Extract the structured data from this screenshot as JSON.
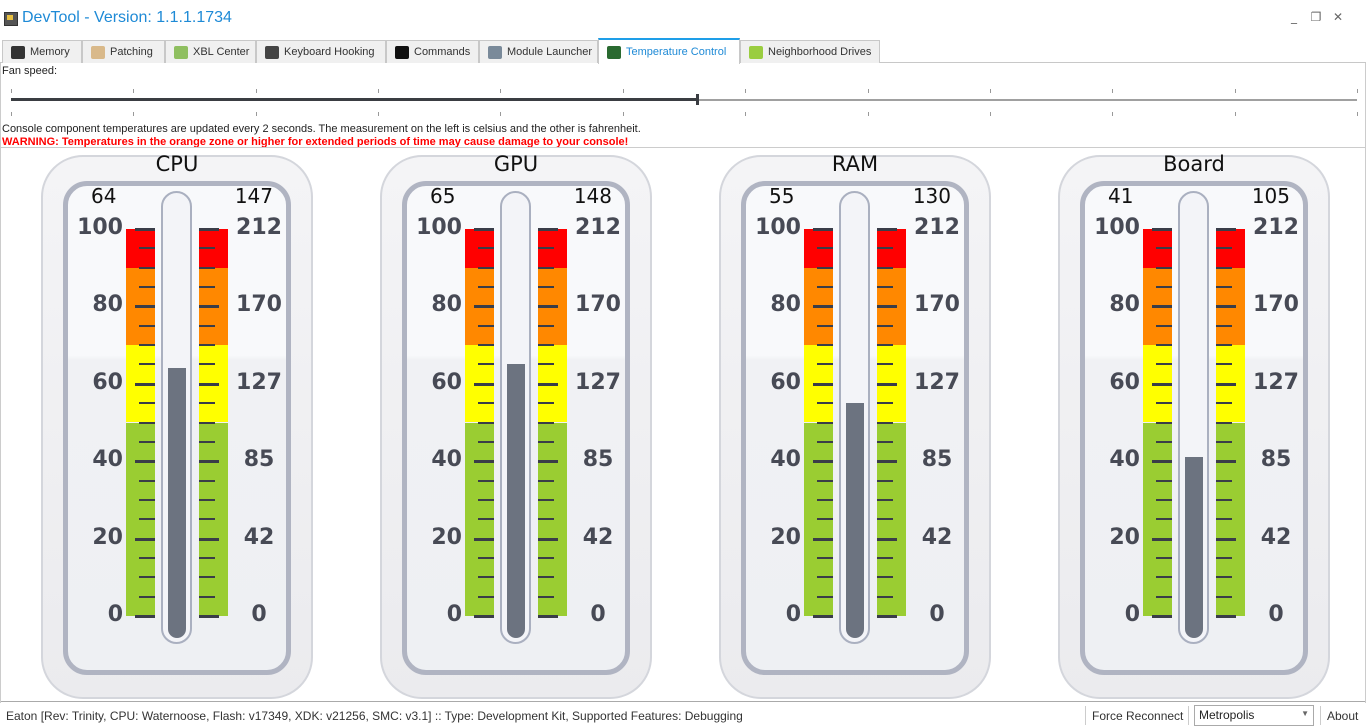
{
  "window": {
    "title": "DevTool - Version: 1.1.1.1734",
    "minimize_icon": "minimize-icon",
    "restore_icon": "restore-icon",
    "close_icon": "close-icon"
  },
  "tabs": [
    {
      "label": "Memory",
      "icon": "memory-chip-icon",
      "color": "#333333"
    },
    {
      "label": "Patching",
      "icon": "bandage-icon",
      "color": "#d9b98a"
    },
    {
      "label": "XBL Center",
      "icon": "xbox-icon",
      "color": "#8fbf60"
    },
    {
      "label": "Keyboard Hooking",
      "icon": "keyboard-icon",
      "color": "#444444"
    },
    {
      "label": "Commands",
      "icon": "console-icon",
      "color": "#111111"
    },
    {
      "label": "Module Launcher",
      "icon": "window-icon",
      "color": "#7a8a9a"
    },
    {
      "label": "Temperature Control",
      "icon": "monitor-graph-icon",
      "color": "#2a6a30",
      "active": true
    },
    {
      "label": "Neighborhood Drives",
      "icon": "drive-icon",
      "color": "#9acd40"
    }
  ],
  "fan": {
    "label": "Fan speed:",
    "value_percent": 51,
    "tick_count": 12
  },
  "info_text": "Console component temperatures are updated every 2 seconds. The measurement on the left is celsius and the other is fahrenheit.",
  "warning_text": "WARNING: Temperatures in the orange zone or higher for extended periods of time may cause damage to your console!",
  "scale": {
    "celsius_labels": [
      "100",
      "80",
      "60",
      "40",
      "20",
      "0"
    ],
    "fahrenheit_labels": [
      "212",
      "170",
      "127",
      "85",
      "42",
      "0"
    ],
    "zones": [
      {
        "from": 90,
        "to": 100,
        "color": "#ff0000"
      },
      {
        "from": 70,
        "to": 90,
        "color": "#ff8800"
      },
      {
        "from": 50,
        "to": 70,
        "color": "#ffff00"
      },
      {
        "from": 0,
        "to": 50,
        "color": "#9acd32"
      }
    ]
  },
  "gauges": [
    {
      "name": "CPU",
      "celsius": "64",
      "fahrenheit": "147"
    },
    {
      "name": "GPU",
      "celsius": "65",
      "fahrenheit": "148"
    },
    {
      "name": "RAM",
      "celsius": "55",
      "fahrenheit": "130"
    },
    {
      "name": "Board",
      "celsius": "41",
      "fahrenheit": "105"
    }
  ],
  "status": {
    "text": "Eaton [Rev: Trinity, CPU: Waternoose, Flash: v17349, XDK: v21256, SMC: v3.1] :: Type: Development Kit, Supported Features: Debugging",
    "force_reconnect": "Force Reconnect",
    "theme": "Metropolis",
    "about": "About"
  }
}
